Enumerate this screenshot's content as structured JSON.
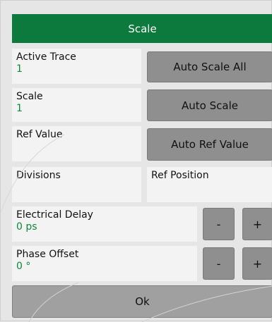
{
  "title": "Scale",
  "active_trace": {
    "label": "Active Trace",
    "value": "1"
  },
  "scale": {
    "label": "Scale",
    "value": "1"
  },
  "ref_value": {
    "label": "Ref Value"
  },
  "divisions": {
    "label": "Divisions"
  },
  "ref_position": {
    "label": "Ref Position"
  },
  "electrical_delay": {
    "label": "Electrical Delay",
    "value": "0 ps"
  },
  "phase_offset": {
    "label": "Phase Offset",
    "value": "0 °"
  },
  "buttons": {
    "auto_scale_all": "Auto Scale All",
    "auto_scale": "Auto Scale",
    "auto_ref_value": "Auto Ref Value",
    "minus": "-",
    "plus": "+",
    "ok": "Ok"
  },
  "colors": {
    "header_bg": "#0c7a3c",
    "value_text": "#0a8a3a",
    "button_bg": "#8f8f8f"
  }
}
